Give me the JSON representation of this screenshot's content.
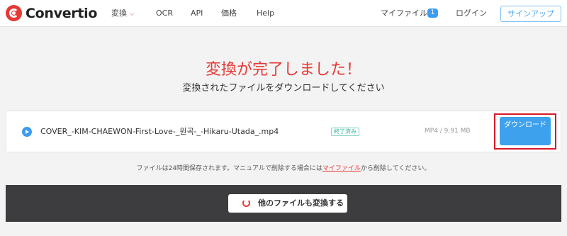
{
  "brand": {
    "name": "Convertio"
  },
  "nav": {
    "convert": "変換",
    "ocr": "OCR",
    "api": "API",
    "price": "価格",
    "help": "Help",
    "my_files": "マイファイル",
    "my_files_count": "1",
    "login": "ログイン",
    "signup": "サインアップ"
  },
  "main": {
    "heading": "変換が完了しました！",
    "subheading": "変換されたファイルをダウンロードしてください"
  },
  "file": {
    "name": "COVER_-KIM-CHAEWON-First-Love-_원곡-_-Hikaru-Utada_.mp4",
    "status": "終了済み",
    "meta": "MP4 / 9.91 MB",
    "download_label": "ダウンロード"
  },
  "notice": {
    "before": "ファイルは24時間保存されます。マニュアルで削除する場合には",
    "link": "マイファイル",
    "after": "から削除してください。"
  },
  "convert_more": {
    "label": "他のファイルも変換する"
  },
  "colors": {
    "accent_red": "#e53935",
    "primary_blue": "#3ea1ee",
    "highlight_red": "#d6182a",
    "dark_band": "#3d3d3f"
  }
}
